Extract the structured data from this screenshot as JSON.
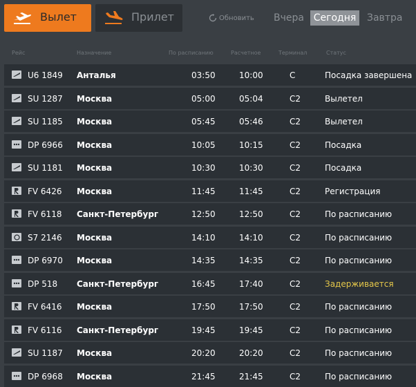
{
  "tabs": {
    "departures": "Вылет",
    "arrivals": "Прилет"
  },
  "refresh": "Обновить",
  "days": {
    "yesterday": "Вчера",
    "today": "Сегодня",
    "tomorrow": "Завтра"
  },
  "columns": {
    "flight": "Рейс",
    "destination": "Назначение",
    "scheduled": "По расписанию",
    "estimated": "Расчетное",
    "terminal": "Терминал",
    "status": "Статус"
  },
  "flights": [
    {
      "flight": "U6 1849",
      "destination": "Анталья",
      "scheduled": "03:50",
      "estimated": "10:00",
      "terminal": "C",
      "status": "Посадка завершена",
      "icon": "plane-icon"
    },
    {
      "flight": "SU 1287",
      "destination": "Москва",
      "scheduled": "05:00",
      "estimated": "05:04",
      "terminal": "C2",
      "status": "Вылетел",
      "icon": "plane-icon"
    },
    {
      "flight": "SU 1185",
      "destination": "Москва",
      "scheduled": "05:45",
      "estimated": "05:46",
      "terminal": "C2",
      "status": "Вылетел",
      "icon": "plane-icon"
    },
    {
      "flight": "DP 6966",
      "destination": "Москва",
      "scheduled": "10:05",
      "estimated": "10:15",
      "terminal": "C2",
      "status": "Посадка",
      "icon": "dots-icon"
    },
    {
      "flight": "SU 1181",
      "destination": "Москва",
      "scheduled": "10:30",
      "estimated": "10:30",
      "terminal": "C2",
      "status": "Посадка",
      "icon": "plane-icon"
    },
    {
      "flight": "FV 6426",
      "destination": "Москва",
      "scheduled": "11:45",
      "estimated": "11:45",
      "terminal": "C2",
      "status": "Регистрация",
      "icon": "r-icon"
    },
    {
      "flight": "FV 6118",
      "destination": "Санкт-Петербург",
      "scheduled": "12:50",
      "estimated": "12:50",
      "terminal": "C2",
      "status": "По расписанию",
      "icon": "r-icon"
    },
    {
      "flight": "S7 2146",
      "destination": "Москва",
      "scheduled": "14:10",
      "estimated": "14:10",
      "terminal": "C2",
      "status": "По расписанию",
      "icon": "s7-icon"
    },
    {
      "flight": "DP 6970",
      "destination": "Москва",
      "scheduled": "14:35",
      "estimated": "14:35",
      "terminal": "C2",
      "status": "По расписанию",
      "icon": "dots-icon"
    },
    {
      "flight": "DP 518",
      "destination": "Санкт-Петербург",
      "scheduled": "16:45",
      "estimated": "17:40",
      "terminal": "C2",
      "status": "Задерживается",
      "icon": "dots-icon"
    },
    {
      "flight": "FV 6416",
      "destination": "Москва",
      "scheduled": "17:50",
      "estimated": "17:50",
      "terminal": "C2",
      "status": "По расписанию",
      "icon": "r-icon"
    },
    {
      "flight": "FV 6116",
      "destination": "Санкт-Петербург",
      "scheduled": "19:45",
      "estimated": "19:45",
      "terminal": "C2",
      "status": "По расписанию",
      "icon": "r-icon"
    },
    {
      "flight": "SU 1187",
      "destination": "Москва",
      "scheduled": "20:20",
      "estimated": "20:20",
      "terminal": "C2",
      "status": "По расписанию",
      "icon": "plane-icon"
    },
    {
      "flight": "DP 6968",
      "destination": "Москва",
      "scheduled": "21:45",
      "estimated": "21:45",
      "terminal": "C2",
      "status": "По расписанию",
      "icon": "dots-icon"
    }
  ],
  "colors": {
    "accent": "#ee7a1e",
    "delayed": "#e6c84a",
    "row": "#2b3035",
    "background": "#3a3f44"
  }
}
